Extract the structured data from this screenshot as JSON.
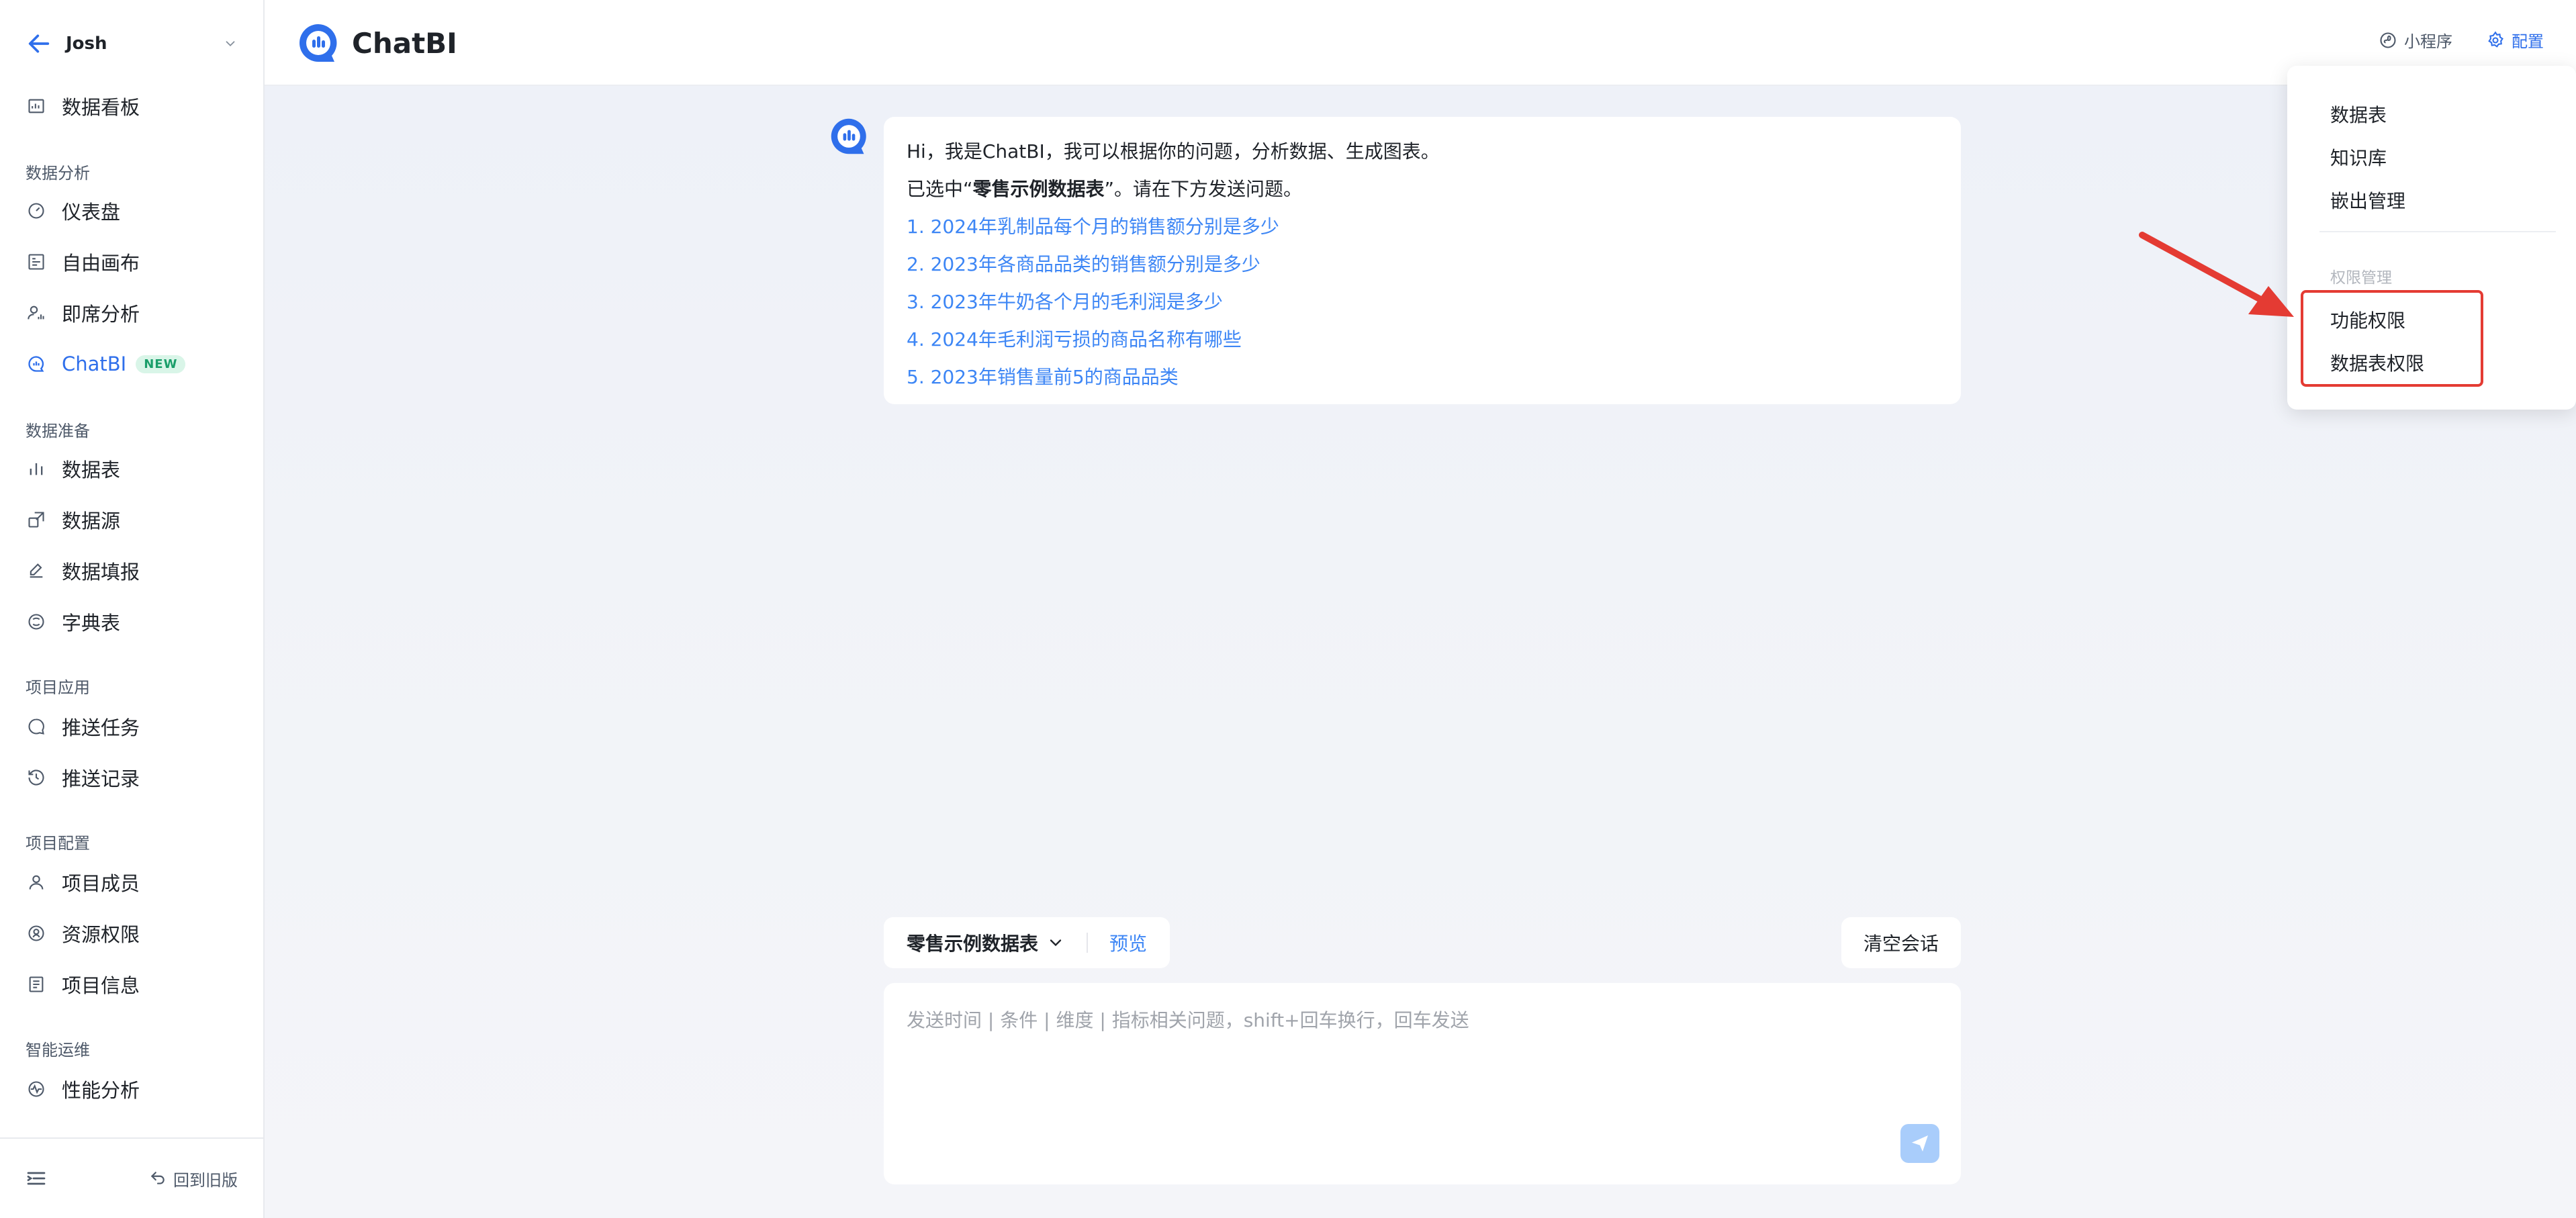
{
  "sidebar": {
    "user": "Josh",
    "top_item": "数据看板",
    "sections": [
      {
        "title": "数据分析",
        "items": [
          "仪表盘",
          "自由画布",
          "即席分析",
          "ChatBI"
        ]
      },
      {
        "title": "数据准备",
        "items": [
          "数据表",
          "数据源",
          "数据填报",
          "字典表"
        ]
      },
      {
        "title": "项目应用",
        "items": [
          "推送任务",
          "推送记录"
        ]
      },
      {
        "title": "项目配置",
        "items": [
          "项目成员",
          "资源权限",
          "项目信息"
        ]
      },
      {
        "title": "智能运维",
        "items": [
          "性能分析"
        ]
      }
    ],
    "new_badge": "NEW",
    "footer_back": "回到旧版"
  },
  "topbar": {
    "brand": "ChatBI",
    "mini_program": "小程序",
    "config": "配置"
  },
  "chat": {
    "greeting": "Hi，我是ChatBI，我可以根据你的问题，分析数据、生成图表。",
    "selected_prefix": "已选中“",
    "selected_table": "零售示例数据表",
    "selected_suffix": "”。请在下方发送问题。",
    "questions": [
      "1. 2024年乳制品每个月的销售额分别是多少",
      "2. 2023年各商品品类的销售额分别是多少",
      "3. 2023年牛奶各个月的毛利润是多少",
      "4. 2024年毛利润亏损的商品名称有哪些",
      "5. 2023年销售量前5的商品品类"
    ]
  },
  "composer": {
    "dataset": "零售示例数据表",
    "preview": "预览",
    "clear": "清空会话",
    "placeholder": "发送时间 | 条件 | 维度 | 指标相关问题，shift+回车换行，回车发送"
  },
  "dropdown": {
    "items": [
      "数据表",
      "知识库",
      "嵌出管理"
    ],
    "group_title": "权限管理",
    "group_items": [
      "功能权限",
      "数据表权限"
    ]
  },
  "colors": {
    "accent": "#2f6feb",
    "link": "#3d86f5",
    "highlight": "#e43b33",
    "new_badge_bg": "#d9f5e8"
  }
}
